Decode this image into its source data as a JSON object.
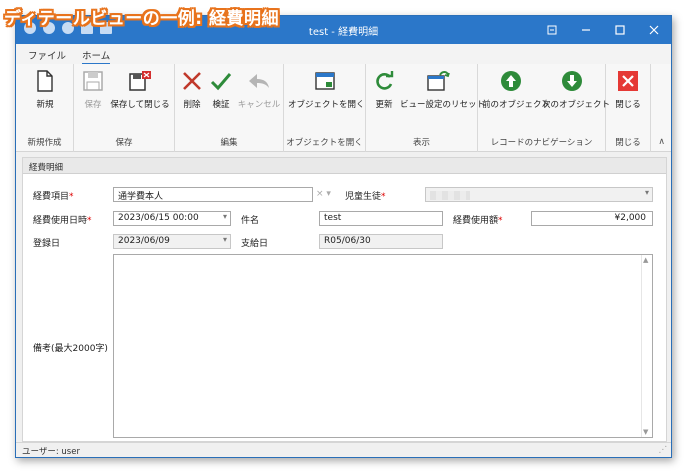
{
  "caption": "ディテールビューの一例: 経費明細",
  "window": {
    "title": "test - 経費明細"
  },
  "titlebar_controls": [
    "pin-icon",
    "minimize-icon",
    "maximize-icon",
    "close-icon"
  ],
  "menu": {
    "file": "ファイル",
    "home": "ホーム"
  },
  "ribbon": {
    "groups": [
      {
        "label": "新規作成",
        "buttons": [
          {
            "label": "新規",
            "icon": "new-document-icon",
            "enabled": true
          }
        ]
      },
      {
        "label": "保存",
        "buttons": [
          {
            "label": "保存",
            "icon": "save-icon",
            "enabled": false
          },
          {
            "label": "保存して閉じる",
            "icon": "save-close-icon",
            "enabled": true
          }
        ]
      },
      {
        "label": "編集",
        "buttons": [
          {
            "label": "削除",
            "icon": "delete-x-icon",
            "enabled": true
          },
          {
            "label": "検証",
            "icon": "checkmark-icon",
            "enabled": true
          },
          {
            "label": "キャンセル",
            "icon": "undo-arrow-icon",
            "enabled": false
          }
        ]
      },
      {
        "label": "オブジェクトを開く",
        "buttons": [
          {
            "label": "オブジェクトを開く",
            "icon": "open-window-icon",
            "enabled": true
          }
        ]
      },
      {
        "label": "表示",
        "buttons": [
          {
            "label": "更新",
            "icon": "refresh-icon",
            "enabled": true
          },
          {
            "label": "ビュー設定のリセット",
            "icon": "reset-view-icon",
            "enabled": true
          }
        ]
      },
      {
        "label": "レコードのナビゲーション",
        "buttons": [
          {
            "label": "前のオブジェクト",
            "icon": "arrow-up-circle-icon",
            "enabled": true
          },
          {
            "label": "次のオブジェクト",
            "icon": "arrow-down-circle-icon",
            "enabled": true
          }
        ]
      },
      {
        "label": "閉じる",
        "buttons": [
          {
            "label": "閉じる",
            "icon": "close-red-icon",
            "enabled": true
          }
        ]
      }
    ]
  },
  "section": {
    "title": "経費明細"
  },
  "form": {
    "expense_item": {
      "label": "経費項目",
      "required": true,
      "value": "通学費本人"
    },
    "student": {
      "label": "児童生徒",
      "required": true,
      "value": ""
    },
    "used_datetime": {
      "label": "経費使用日時",
      "required": true,
      "value": "2023/06/15 00:00"
    },
    "subject": {
      "label": "件名",
      "value": "test"
    },
    "amount": {
      "label": "経費使用額",
      "required": true,
      "value": "¥2,000"
    },
    "registered_date": {
      "label": "登録日",
      "value": "2023/06/09"
    },
    "payment_date": {
      "label": "支給日",
      "value": "R05/06/30"
    },
    "notes": {
      "label": "備考(最大2000字)",
      "value": ""
    }
  },
  "status": {
    "user": "ユーザー: user"
  },
  "colors": {
    "titlebar": "#2b77c9",
    "delete": "#c0392b",
    "verify": "#2e8b3a",
    "nav": "#2e8b3a",
    "close": "#e53935"
  }
}
